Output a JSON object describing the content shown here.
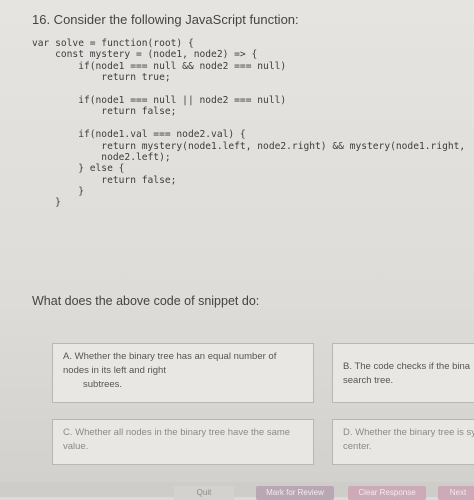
{
  "question": {
    "title": "16. Consider the following JavaScript function:",
    "code_lines": [
      "var solve = function(root) {",
      "    const mystery = (node1, node2) => {",
      "        if(node1 === null && node2 === null)",
      "            return true;",
      "",
      "        if(node1 === null || node2 === null)",
      "            return false;",
      "",
      "        if(node1.val === node2.val) {",
      "            return mystery(node1.left, node2.right) && mystery(node1.right,",
      "            node2.left);",
      "        } else {",
      "            return false;",
      "        }",
      "    }"
    ],
    "prompt": "What does the above code of snippet do:"
  },
  "options": {
    "a": {
      "line1": "A. Whether the binary tree has an equal number of",
      "line2": "nodes in its left and right",
      "line3": "subtrees."
    },
    "b": {
      "line1": "B. The code checks if the bina",
      "line2": "search tree."
    },
    "c": {
      "line1": "C. Whether all nodes in the binary tree have the same",
      "line2": "value."
    },
    "d": {
      "line1": "D. Whether the binary tree is sy",
      "line2": "center."
    }
  },
  "buttons": {
    "quit": "Quit",
    "mark": "Mark for Review",
    "clear": "Clear Response",
    "next": "Next"
  }
}
